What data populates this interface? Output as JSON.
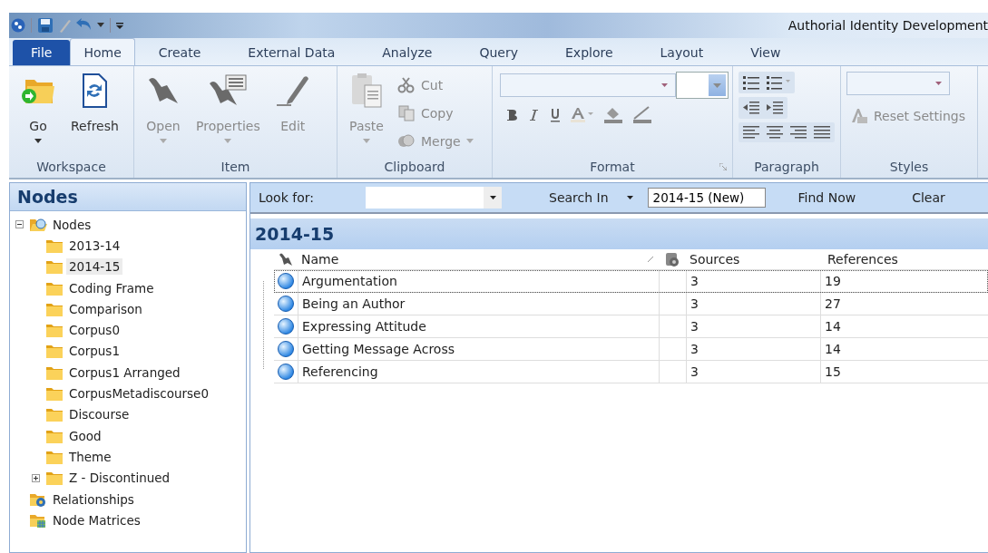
{
  "window": {
    "title": "Authorial Identity Development"
  },
  "tabs": [
    {
      "label": "File",
      "selected": false,
      "kind": "file"
    },
    {
      "label": "Home",
      "selected": true,
      "kind": "tab"
    },
    {
      "label": "Create",
      "selected": false,
      "kind": "tab"
    },
    {
      "label": "External Data",
      "selected": false,
      "kind": "tab"
    },
    {
      "label": "Analyze",
      "selected": false,
      "kind": "tab"
    },
    {
      "label": "Query",
      "selected": false,
      "kind": "tab"
    },
    {
      "label": "Explore",
      "selected": false,
      "kind": "tab"
    },
    {
      "label": "Layout",
      "selected": false,
      "kind": "tab"
    },
    {
      "label": "View",
      "selected": false,
      "kind": "tab"
    }
  ],
  "ribbon": {
    "groups": [
      {
        "label": "Workspace",
        "buttons": [
          {
            "label": "Go",
            "disabled": false,
            "dropdown": true
          },
          {
            "label": "Refresh",
            "disabled": false,
            "dropdown": false
          }
        ]
      },
      {
        "label": "Item",
        "buttons": [
          {
            "label": "Open",
            "disabled": true,
            "dropdown": true
          },
          {
            "label": "Properties",
            "disabled": true,
            "dropdown": true
          },
          {
            "label": "Edit",
            "disabled": true,
            "dropdown": false
          }
        ]
      },
      {
        "label": "Clipboard",
        "buttons": [
          {
            "label": "Paste",
            "disabled": true,
            "dropdown": true
          }
        ],
        "small": [
          {
            "label": "Cut",
            "disabled": true
          },
          {
            "label": "Copy",
            "disabled": true
          },
          {
            "label": "Merge",
            "disabled": true
          }
        ]
      },
      {
        "label": "Format"
      },
      {
        "label": "Paragraph"
      },
      {
        "label": "Styles",
        "small": [
          {
            "label": "Reset Settings",
            "disabled": true
          }
        ]
      }
    ]
  },
  "navigation": {
    "title": "Nodes",
    "tree": [
      {
        "label": "Nodes",
        "expanded": true,
        "selected": false,
        "children": [
          {
            "label": "2013-14",
            "selected": false
          },
          {
            "label": "2014-15",
            "selected": true
          },
          {
            "label": "Coding Frame",
            "selected": false
          },
          {
            "label": "Comparison",
            "selected": false
          },
          {
            "label": "Corpus0",
            "selected": false
          },
          {
            "label": "Corpus1",
            "selected": false
          },
          {
            "label": "Corpus1 Arranged",
            "selected": false
          },
          {
            "label": "CorpusMetadiscourse0",
            "selected": false
          },
          {
            "label": "Discourse",
            "selected": false
          },
          {
            "label": "Good",
            "selected": false
          },
          {
            "label": "Theme",
            "selected": false
          },
          {
            "label": "Z - Discontinued",
            "selected": false,
            "expanded": false
          }
        ]
      },
      {
        "label": "Relationships",
        "selected": false
      },
      {
        "label": "Node Matrices",
        "selected": false
      }
    ]
  },
  "find_bar": {
    "look_for_label": "Look for:",
    "search_in": "Search In",
    "scope": "2014-15 (New)",
    "find_now": "Find Now",
    "clear": "Clear"
  },
  "list": {
    "title": "2014-15",
    "columns": [
      "Name",
      "Sources",
      "References"
    ],
    "rows": [
      {
        "name": "Argumentation",
        "sources": "3",
        "references": "19",
        "selected": true
      },
      {
        "name": "Being an Author",
        "sources": "3",
        "references": "27",
        "selected": false
      },
      {
        "name": "Expressing Attitude",
        "sources": "3",
        "references": "14",
        "selected": false
      },
      {
        "name": "Getting Message Across",
        "sources": "3",
        "references": "14",
        "selected": false
      },
      {
        "name": "Referencing",
        "sources": "3",
        "references": "15",
        "selected": false
      }
    ]
  }
}
